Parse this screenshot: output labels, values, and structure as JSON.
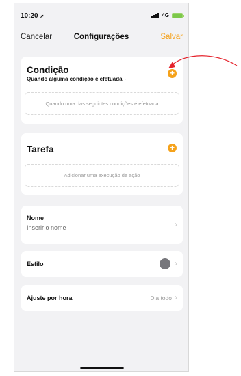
{
  "status_bar": {
    "time": "10:20",
    "network": "4G"
  },
  "nav": {
    "cancel_label": "Cancelar",
    "title": "Configurações",
    "save_label": "Salvar"
  },
  "condition": {
    "title": "Condição",
    "subtitle": "Quando alguma condição é efetuada",
    "placeholder": "Quando uma das seguintes condições é efetuada"
  },
  "task": {
    "title": "Tarefa",
    "placeholder": "Adicionar uma execução de ação"
  },
  "name": {
    "label": "Nome",
    "value": "Inserir o nome"
  },
  "style": {
    "label": "Estilo",
    "color": "#77777c"
  },
  "schedule": {
    "label": "Ajuste por hora",
    "value": "Dia todo"
  },
  "colors": {
    "accent": "#f5a21b",
    "annotation": "#e5222b"
  },
  "icons": {
    "add": "plus-circle-icon",
    "chevron": "chevron-right-icon",
    "location": "location-arrow-icon",
    "signal": "signal-bars-icon",
    "battery": "battery-icon"
  }
}
